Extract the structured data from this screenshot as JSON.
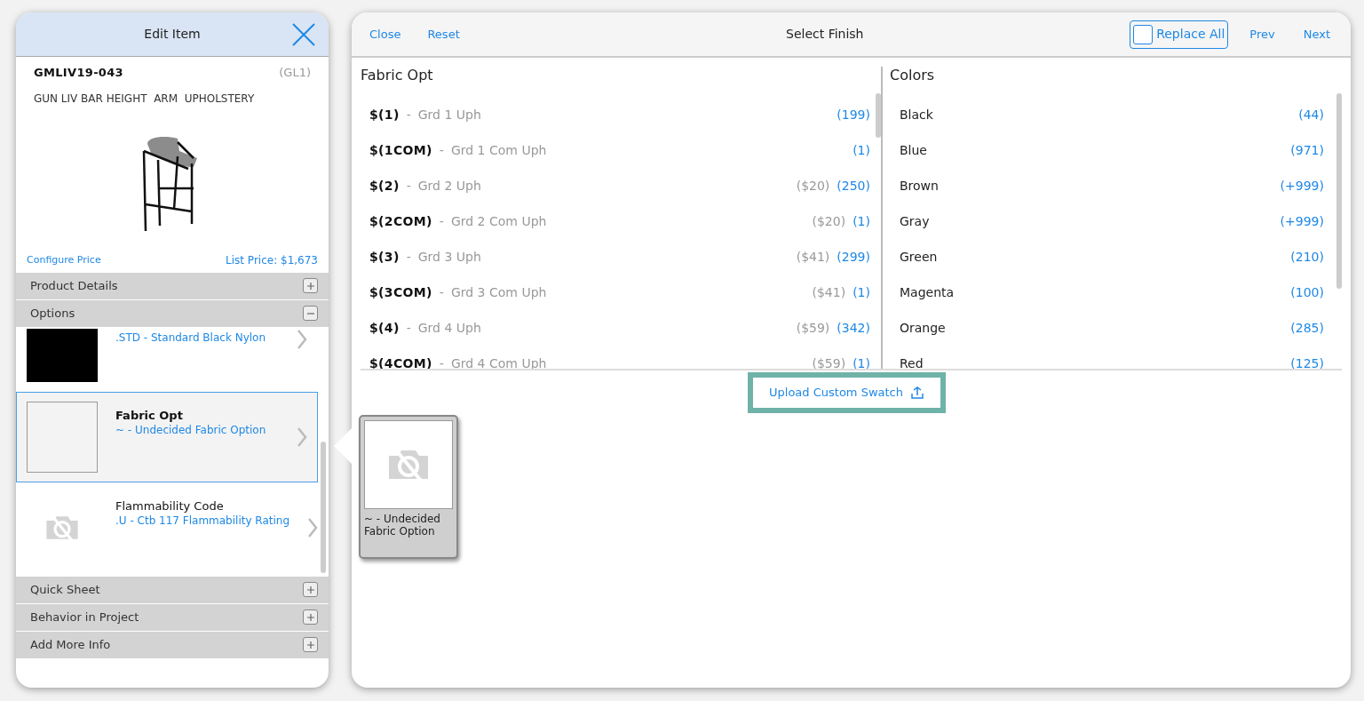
{
  "edit_panel": {
    "title": "Edit Item",
    "sku": "GMLIV19-043",
    "code": "(GL1)",
    "description": "GUN LIV BAR HEIGHT  ARM  UPHOLSTERY",
    "configure_link": "Configure Price",
    "list_price": "List Price: $1,673",
    "sections_top": [
      {
        "label": "Product Details",
        "expanded": false
      },
      {
        "label": "Options",
        "expanded": true
      }
    ],
    "options": [
      {
        "kind": "solid",
        "color": "#000000",
        "title_visible": false,
        "value": ".STD - Standard Black Nylon",
        "selected": false
      },
      {
        "kind": "blank",
        "title": "Fabric Opt",
        "title_bold": true,
        "value": "~ - Undecided Fabric Option",
        "selected": true
      },
      {
        "kind": "no-image",
        "title": "Flammability Code",
        "title_bold": false,
        "value": ".U - Ctb 117 Flammability Rating",
        "selected": false
      }
    ],
    "sections_bottom": [
      {
        "label": "Quick Sheet",
        "expanded": false
      },
      {
        "label": "Behavior in Project",
        "expanded": false
      },
      {
        "label": "Add More Info",
        "expanded": false
      }
    ]
  },
  "finish_panel": {
    "close": "Close",
    "reset": "Reset",
    "title": "Select Finish",
    "replace_all": {
      "label": "Replace All",
      "checked": false
    },
    "prev": "Prev",
    "next": "Next",
    "fabric": {
      "heading": "Fabric Opt",
      "rows": [
        {
          "code": "$(1)",
          "sep": "-",
          "name": "Grd 1 Uph",
          "count": "(199)"
        },
        {
          "code": "$(1COM)",
          "sep": "-",
          "name": "Grd 1 Com Uph",
          "count": "(1)"
        },
        {
          "code": "$(2)",
          "sep": "-",
          "name": "Grd 2 Uph",
          "price": "($20)",
          "count": "(250)"
        },
        {
          "code": "$(2COM)",
          "sep": "-",
          "name": "Grd 2 Com Uph",
          "price": "($20)",
          "count": "(1)"
        },
        {
          "code": "$(3)",
          "sep": "-",
          "name": "Grd 3 Uph",
          "price": "($41)",
          "count": "(299)"
        },
        {
          "code": "$(3COM)",
          "sep": "-",
          "name": "Grd 3 Com Uph",
          "price": "($41)",
          "count": "(1)"
        },
        {
          "code": "$(4)",
          "sep": "-",
          "name": "Grd 4 Uph",
          "price": "($59)",
          "count": "(342)"
        },
        {
          "code": "$(4COM)",
          "sep": "-",
          "name": "Grd 4 Com Uph",
          "price": "($59)",
          "count": "(1)"
        }
      ]
    },
    "colors": {
      "heading": "Colors",
      "rows": [
        {
          "name": "Black",
          "count": "(44)"
        },
        {
          "name": "Blue",
          "count": "(971)"
        },
        {
          "name": "Brown",
          "count": "(+999)"
        },
        {
          "name": "Gray",
          "count": "(+999)"
        },
        {
          "name": "Green",
          "count": "(210)"
        },
        {
          "name": "Magenta",
          "count": "(100)"
        },
        {
          "name": "Orange",
          "count": "(285)"
        },
        {
          "name": "Red",
          "count": "(125)"
        }
      ]
    },
    "upload_button": "Upload Custom Swatch",
    "current_swatch": {
      "label": "~ - Undecided Fabric Option"
    }
  }
}
